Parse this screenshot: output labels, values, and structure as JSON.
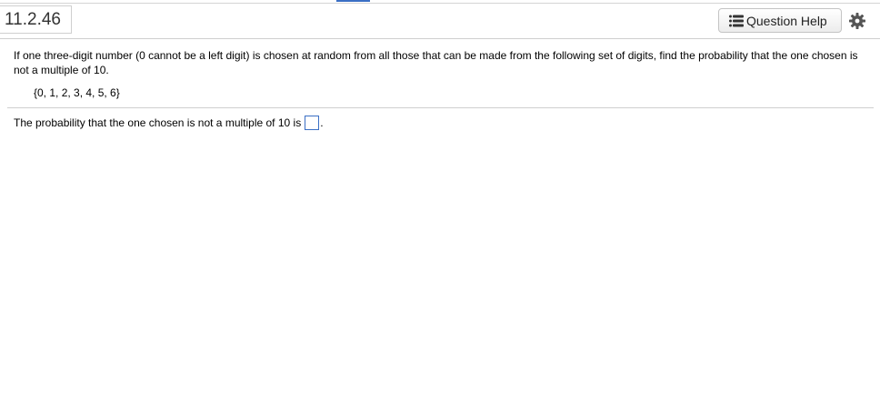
{
  "header": {
    "question_number": "11.2.46",
    "help_button_label": "Question Help",
    "help_icon": "list-icon",
    "settings_icon": "gear-icon"
  },
  "question": {
    "text": "If one three-digit number (0 cannot be a left digit) is chosen at random from all those that can be made from the following set of digits, find the probability that the one chosen is not a multiple of 10.",
    "digit_set": "{0, 1, 2, 3, 4, 5, 6}"
  },
  "answer": {
    "prompt": "The probability that the one chosen is not a multiple of 10 is",
    "value": "",
    "suffix": "."
  },
  "colors": {
    "accent": "#3b6fc4",
    "border": "#cfcfcf"
  }
}
